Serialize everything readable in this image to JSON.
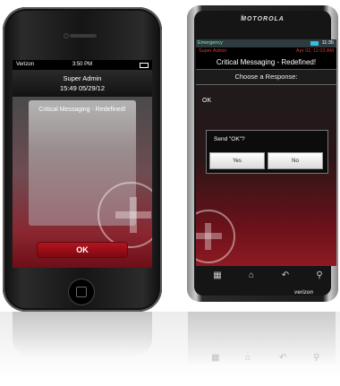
{
  "iphone": {
    "status": {
      "carrier": "Verizon",
      "time": "3:50 PM"
    },
    "sender": "Super Admin",
    "timestamp": "15:49 05/29/12",
    "message_title": "Critical Messaging - Redefined!",
    "ok_label": "OK"
  },
  "android": {
    "brand": "MOTOROLA",
    "status": {
      "label": "Emergency",
      "time": "11:35"
    },
    "sender": "Super Admin",
    "date": "Apr 02, 11:03 AM",
    "message_title": "Critical Messaging - Redefined!",
    "prompt": "Choose a Response:",
    "response_option": "OK",
    "dialog": {
      "question": "Send \"OK\"?",
      "yes_label": "Yes",
      "no_label": "No"
    },
    "softkeys": [
      "menu-icon",
      "home-icon",
      "back-icon",
      "search-icon"
    ],
    "carrier_logo": "verizon"
  },
  "colors": {
    "accent_red": "#b5141f",
    "dark_red": "#7e0811",
    "header_red_text": "#dd3333"
  }
}
